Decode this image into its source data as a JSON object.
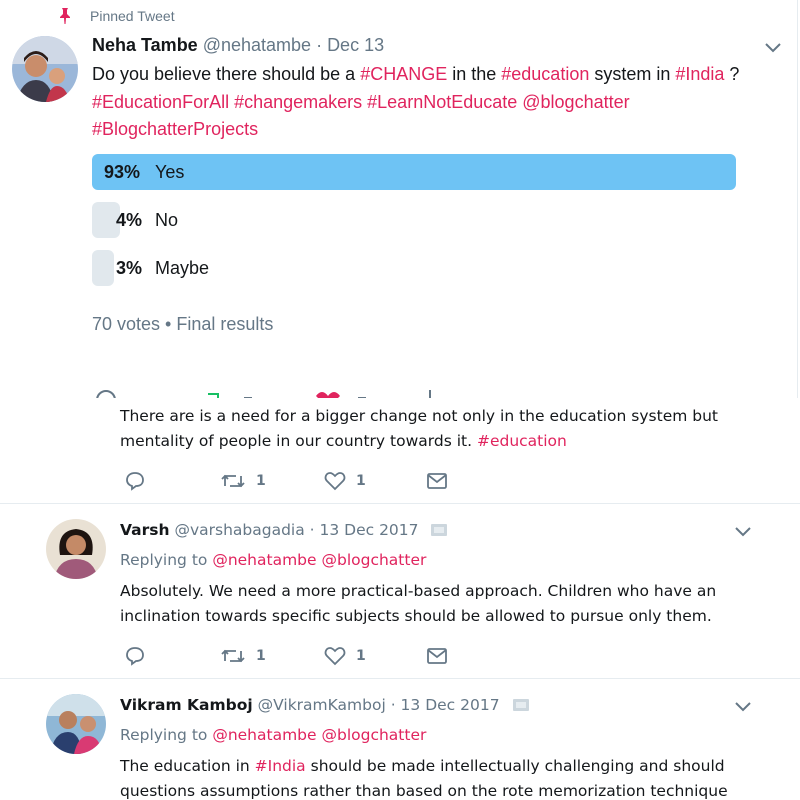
{
  "pinned": {
    "label": "Pinned Tweet"
  },
  "main_tweet": {
    "name": "Neha Tambe",
    "handle": "@nehatambe",
    "sep": " · ",
    "date": "Dec 13",
    "text_1": "Do you believe there should be a ",
    "tag_change": "#CHANGE",
    "text_2": " in the ",
    "tag_education": "#education",
    "text_3": " system in ",
    "tag_india": "#India",
    "text_4": " ?",
    "line2": "#EducationForAll #changemakers #LearnNotEducate @blogchatter",
    "line3": "#BlogchatterProjects",
    "poll": {
      "options": [
        {
          "pct": "93%",
          "label": "Yes",
          "value": 93
        },
        {
          "pct": "4%",
          "label": "No",
          "value": 4
        },
        {
          "pct": "3%",
          "label": "Maybe",
          "value": 3
        }
      ],
      "meta": "70 votes • Final results"
    }
  },
  "reply0": {
    "text_1": "There are is a need for a bigger change not only in the education system but",
    "text_2": "mentality of people in our country towards it. ",
    "tag": "#education",
    "retweets": "1",
    "likes": "1"
  },
  "reply1": {
    "name": "Varsh",
    "handle": "@varshabagadia",
    "date": " · 13 Dec 2017",
    "replying_prefix": "Replying to ",
    "mention1": "@nehatambe",
    "mention2": "@blogchatter",
    "text_1": "Absolutely. We need a more practical-based approach. Children who have an",
    "text_2": "inclination towards specific subjects should be allowed to pursue only them.",
    "retweets": "1",
    "likes": "1"
  },
  "reply2": {
    "name": "Vikram Kamboj",
    "handle": "@VikramKamboj",
    "date": " · 13 Dec 2017",
    "replying_prefix": "Replying to ",
    "mention1": "@nehatambe",
    "mention2": "@blogchatter",
    "text_1a": "The education in ",
    "tag": "#India",
    "text_1b": " should be made intellectually challenging and should",
    "text_2": "questions assumptions rather than based on the rote memorization technique"
  },
  "colors": {
    "accent": "#e0245e",
    "poll_winner": "#6ec3f4",
    "poll_other": "#e1e8ed",
    "secondary_text": "#657786",
    "icon": "#657786"
  },
  "icons": [
    "pin-icon",
    "chevron-down-icon",
    "reply-icon",
    "retweet-icon",
    "like-icon",
    "dm-icon",
    "flag-icon"
  ]
}
